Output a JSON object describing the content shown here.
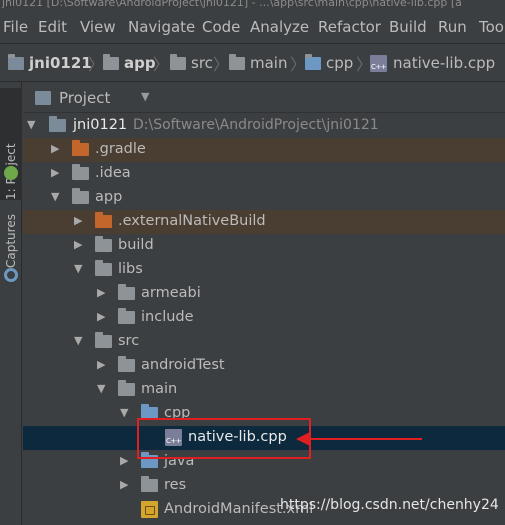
{
  "window_title": "jni0121 [D:\\Software\\AndroidProject\\jni0121] - ...\\app\\src\\main\\cpp\\native-lib.cpp [a",
  "menu": [
    "File",
    "Edit",
    "View",
    "Navigate",
    "Code",
    "Analyze",
    "Refactor",
    "Build",
    "Run",
    "Too"
  ],
  "breadcrumbs": [
    "jni0121",
    "app",
    "src",
    "main",
    "cpp",
    "native-lib.cpp"
  ],
  "side_tabs": {
    "project": "1: Project",
    "captures": "Captures"
  },
  "panel": {
    "title": "Project",
    "dropdown_icon": "triangle-down"
  },
  "tree": [
    {
      "label": "jni0121",
      "path": "D:\\Software\\AndroidProject\\jni0121",
      "expanded": true
    },
    {
      "label": ".gradle",
      "expanded": false
    },
    {
      "label": ".idea",
      "expanded": false
    },
    {
      "label": "app",
      "expanded": true
    },
    {
      "label": ".externalNativeBuild",
      "expanded": false
    },
    {
      "label": "build",
      "expanded": false
    },
    {
      "label": "libs",
      "expanded": true
    },
    {
      "label": "armeabi",
      "expanded": false
    },
    {
      "label": "include",
      "expanded": false
    },
    {
      "label": "src",
      "expanded": true
    },
    {
      "label": "androidTest",
      "expanded": false
    },
    {
      "label": "main",
      "expanded": true
    },
    {
      "label": "cpp",
      "expanded": true
    },
    {
      "label": "native-lib.cpp",
      "selected": true
    },
    {
      "label": "java",
      "expanded": false
    },
    {
      "label": "res",
      "expanded": false
    },
    {
      "label": "AndroidManifest.xml"
    }
  ],
  "watermark": "https://blog.csdn.net/chenhy24",
  "colors": {
    "background": "#3c3f41",
    "selection": "#0d293e",
    "annotation": "#e02020",
    "folder_orange": "#c2662c",
    "folder_blue": "#6d98c4"
  }
}
